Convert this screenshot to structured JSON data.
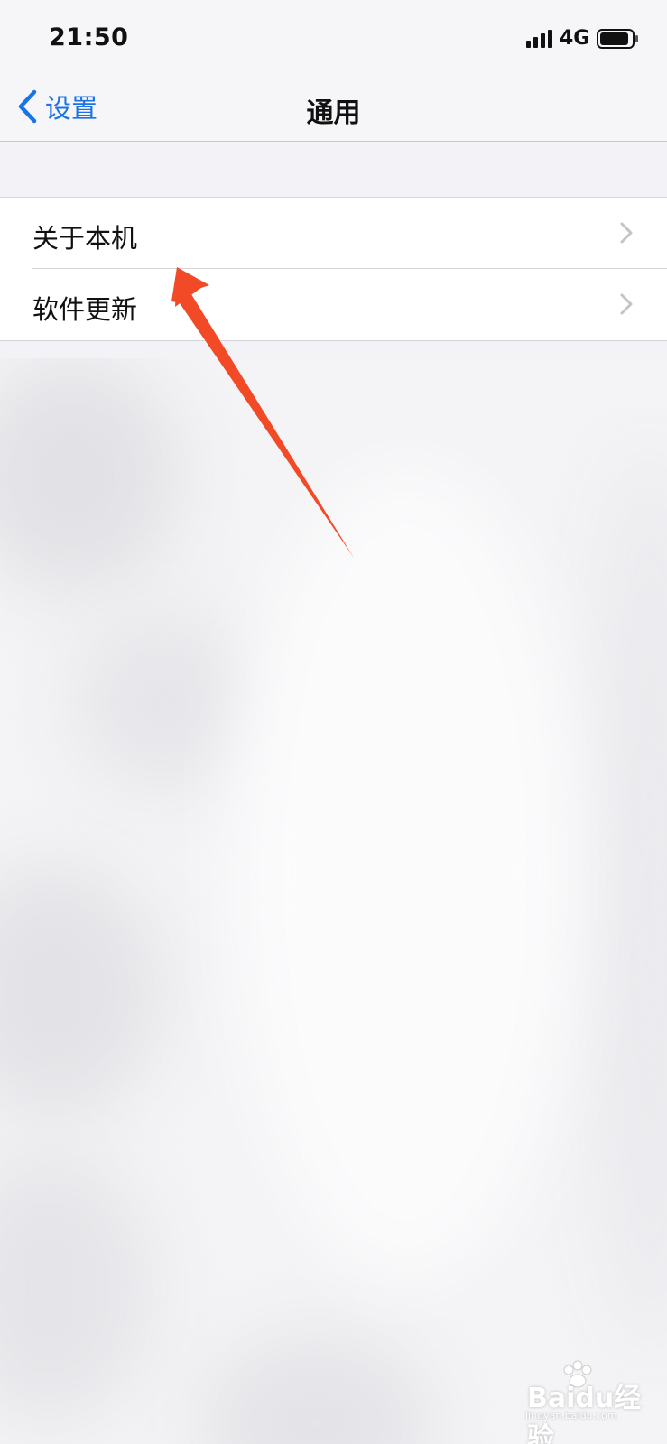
{
  "status_bar": {
    "time": "21:50",
    "network": "4G",
    "signal_icon": "signal-bars-icon",
    "battery_icon": "battery-icon"
  },
  "nav": {
    "back_label": "设置",
    "title": "通用",
    "back_icon": "chevron-left-icon"
  },
  "list": {
    "items": [
      {
        "label": "关于本机",
        "icon": "chevron-right-icon"
      },
      {
        "label": "软件更新",
        "icon": "chevron-right-icon"
      }
    ]
  },
  "watermark": {
    "text": "Baidu经验",
    "sub": "jingyan.baidu.com"
  },
  "colors": {
    "accent": "#1a73e8",
    "arrow": "#f24a26",
    "background": "#f2f2f7"
  }
}
